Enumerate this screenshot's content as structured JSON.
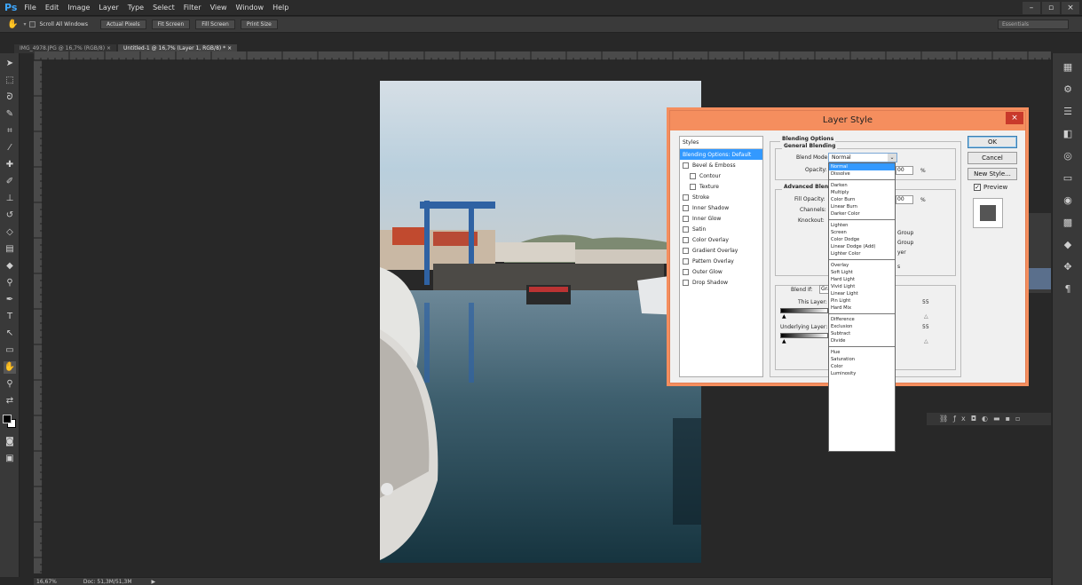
{
  "app": {
    "logo": "Ps",
    "menu": [
      "File",
      "Edit",
      "Image",
      "Layer",
      "Type",
      "Select",
      "Filter",
      "View",
      "Window",
      "Help"
    ],
    "window_controls": [
      "–",
      "▫",
      "×"
    ]
  },
  "options_bar": {
    "scroll_all": "Scroll All Windows",
    "buttons": [
      "Actual Pixels",
      "Fit Screen",
      "Fill Screen",
      "Print Size"
    ],
    "workspace": "Essentials"
  },
  "doc_tabs": [
    {
      "label": "IMG_4978.JPG @ 16,7% (RGB/8)",
      "close": "×"
    },
    {
      "label": "Untitled-1 @ 16,7% (Layer 1, RGB/8) *",
      "close": "×"
    }
  ],
  "status": {
    "zoom": "16,67%",
    "doc": "Doc: 51,3M/51,3M"
  },
  "dialog": {
    "title": "Layer Style",
    "close": "×",
    "styles_header": "Styles",
    "styles": [
      {
        "label": "Blending Options: Default",
        "selected": true,
        "checkbox": false
      },
      {
        "label": "Bevel & Emboss",
        "checkbox": true
      },
      {
        "label": "Contour",
        "checkbox": true,
        "indent": true
      },
      {
        "label": "Texture",
        "checkbox": true,
        "indent": true
      },
      {
        "label": "Stroke",
        "checkbox": true
      },
      {
        "label": "Inner Shadow",
        "checkbox": true
      },
      {
        "label": "Inner Glow",
        "checkbox": true
      },
      {
        "label": "Satin",
        "checkbox": true
      },
      {
        "label": "Color Overlay",
        "checkbox": true
      },
      {
        "label": "Gradient Overlay",
        "checkbox": true
      },
      {
        "label": "Pattern Overlay",
        "checkbox": true
      },
      {
        "label": "Outer Glow",
        "checkbox": true
      },
      {
        "label": "Drop Shadow",
        "checkbox": true
      }
    ],
    "blending_options": "Blending Options",
    "general_blending": "General Blending",
    "blend_mode_label": "Blend Mode:",
    "blend_mode_value": "Normal",
    "opacity_label": "Opacity:",
    "opacity_value": "00",
    "percent": "%",
    "advanced_blending": "Advanced Blen",
    "fill_opacity_label": "Fill Opacity:",
    "fill_opacity_value": "00",
    "channels_label": "Channels:",
    "knockout_label": "Knockout:",
    "group_1": "Group",
    "group_2": "Group",
    "layer_partial": "yer",
    "s_partial": "s",
    "blend_if_label": "Blend If:",
    "blend_if_value": "Gra",
    "this_layer_label": "This Layer:",
    "underlying_label": "Underlying Layer:",
    "val_55a": "55",
    "val_55b": "55",
    "buttons": {
      "ok": "OK",
      "cancel": "Cancel",
      "new_style": "New Style..."
    },
    "preview_label": "Preview",
    "preview_checked": true
  },
  "blend_modes": [
    [
      "Normal",
      "Dissolve"
    ],
    [
      "Darken",
      "Multiply",
      "Color Burn",
      "Linear Burn",
      "Darker Color"
    ],
    [
      "Lighten",
      "Screen",
      "Color Dodge",
      "Linear Dodge (Add)",
      "Lighter Color"
    ],
    [
      "Overlay",
      "Soft Light",
      "Hard Light",
      "Vivid Light",
      "Linear Light",
      "Pin Light",
      "Hard Mix"
    ],
    [
      "Difference",
      "Exclusion",
      "Subtract",
      "Divide"
    ],
    [
      "Hue",
      "Saturation",
      "Color",
      "Luminosity"
    ]
  ],
  "colors": {
    "accent": "#3399ff",
    "dialog_title": "#f58e5e",
    "close": "#c9392b"
  }
}
